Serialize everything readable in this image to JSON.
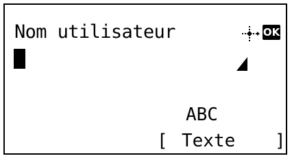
{
  "screen": {
    "title": "Nom utilisateur",
    "ok_label": "OK",
    "nav_icon": "four-way-arrow-icon",
    "input_value": "",
    "input_mode": "ABC",
    "softkey": {
      "bracket_open": "[",
      "label": "Texte",
      "bracket_close": "]"
    }
  },
  "colors": {
    "foreground": "#000000",
    "background": "#ffffff"
  }
}
